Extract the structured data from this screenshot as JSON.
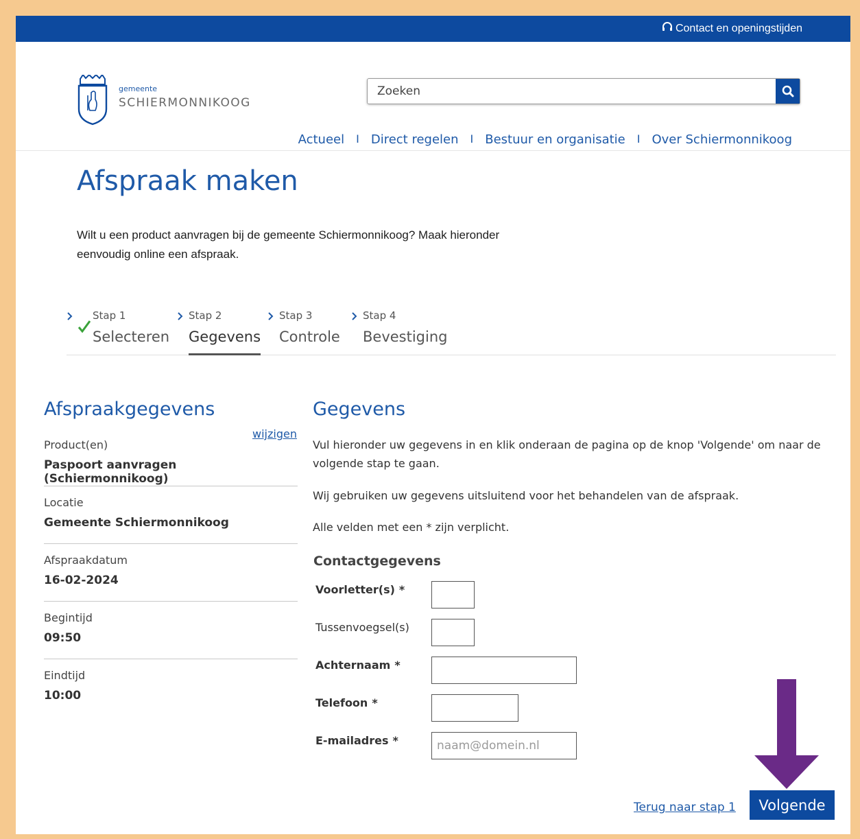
{
  "topbar": {
    "contact_label": "Contact en openingstijden"
  },
  "logo": {
    "small_text": "gemeente",
    "big_text": "SCHIERMONNIKOOG"
  },
  "search": {
    "placeholder": "Zoeken"
  },
  "nav": {
    "items": [
      "Actueel",
      "Direct regelen",
      "Bestuur en organisatie",
      "Over Schiermonnikoog"
    ],
    "separator": "I"
  },
  "page": {
    "title": "Afspraak maken",
    "intro": "Wilt u een product aanvragen bij de gemeente Schiermonnikoog? Maak hieronder eenvoudig online een afspraak."
  },
  "steps": [
    {
      "num": "Stap 1",
      "label": "Selecteren",
      "done": true
    },
    {
      "num": "Stap 2",
      "label": "Gegevens",
      "active": true
    },
    {
      "num": "Stap 3",
      "label": "Controle"
    },
    {
      "num": "Stap 4",
      "label": "Bevestiging"
    }
  ],
  "summary": {
    "title": "Afspraakgegevens",
    "edit_label": "wijzigen",
    "items": [
      {
        "key": "Product(en)",
        "value": "Paspoort aanvragen (Schiermonnikoog)"
      },
      {
        "key": "Locatie",
        "value": "Gemeente Schiermonnikoog"
      },
      {
        "key": "Afspraakdatum",
        "value": "16-02-2024"
      },
      {
        "key": "Begintijd",
        "value": "09:50"
      },
      {
        "key": "Eindtijd",
        "value": "10:00"
      }
    ]
  },
  "form": {
    "title": "Gegevens",
    "paragraph1": "Vul hieronder uw gegevens in en klik onderaan de pagina op de knop 'Volgende' om naar de volgende stap te gaan.",
    "paragraph2": "Wij gebruiken uw gegevens uitsluitend voor het behandelen van de afspraak.",
    "paragraph3": "Alle velden met een * zijn verplicht.",
    "section_title": "Contactgegevens",
    "fields": [
      {
        "label": "Voorletter(s)",
        "required": true,
        "placeholder": ""
      },
      {
        "label": "Tussenvoegsel(s)",
        "required": false,
        "placeholder": ""
      },
      {
        "label": "Achternaam",
        "required": true,
        "placeholder": ""
      },
      {
        "label": "Telefoon",
        "required": true,
        "placeholder": ""
      },
      {
        "label": "E-mailadres",
        "required": true,
        "placeholder": "naam@domein.nl"
      }
    ],
    "required_marker": "*"
  },
  "actions": {
    "back_label": "Terug naar stap 1",
    "next_label": "Volgende"
  },
  "colors": {
    "brand_blue": "#0d4a9f",
    "link_blue": "#1f5aa8",
    "frame": "#f6c98f",
    "arrow": "#6a2a87",
    "check": "#3aa23a"
  }
}
